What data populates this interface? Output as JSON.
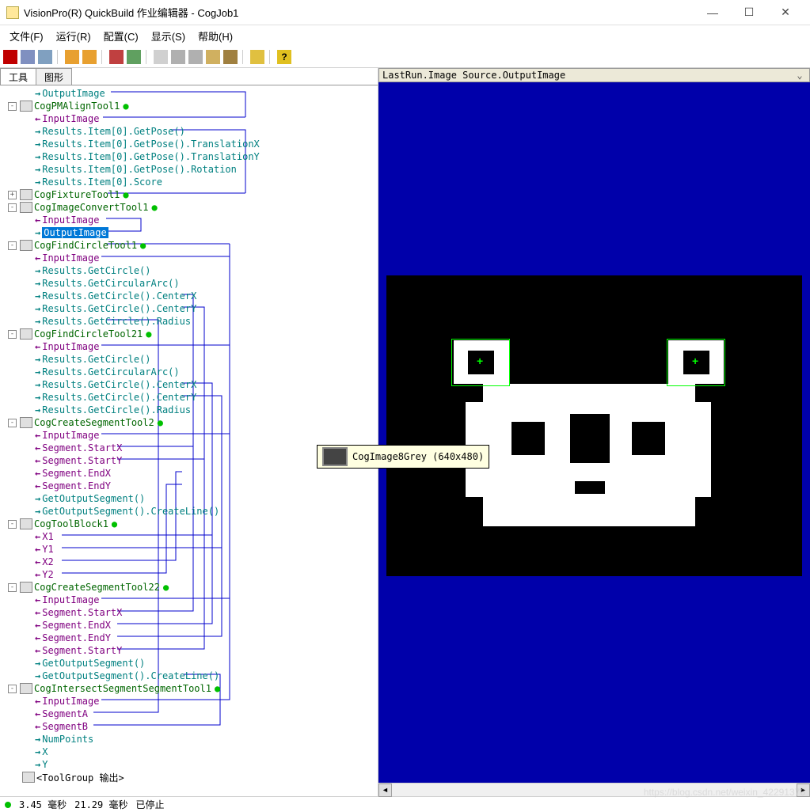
{
  "title": "VisionPro(R) QuickBuild 作业编辑器 - CogJob1",
  "menu": {
    "file": "文件(F)",
    "run": "运行(R)",
    "config": "配置(C)",
    "show": "显示(S)",
    "help": "帮助(H)"
  },
  "tabs": {
    "tools": "工具",
    "graphics": "图形"
  },
  "image_header": "LastRun.Image Source.OutputImage",
  "tooltip": "CogImage8Grey (640x480)",
  "status": {
    "t1": "3.45 毫秒",
    "t2": "21.29 毫秒",
    "state": "已停止"
  },
  "watermark": "https://blog.csdn.net/weixin_42291376",
  "tree": [
    {
      "indent": 42,
      "arrow": "out",
      "text": "OutputImage",
      "cls": "label-out"
    },
    {
      "indent": 10,
      "exp": "-",
      "icon": true,
      "text": "CogPMAlignTool1",
      "cls": "label-tool",
      "dot": true
    },
    {
      "indent": 42,
      "arrow": "in",
      "text": "InputImage",
      "cls": "label-in"
    },
    {
      "indent": 42,
      "arrow": "out",
      "text": "Results.Item[0].GetPose()",
      "cls": "label-out"
    },
    {
      "indent": 42,
      "arrow": "out",
      "text": "Results.Item[0].GetPose().TranslationX",
      "cls": "label-out"
    },
    {
      "indent": 42,
      "arrow": "out",
      "text": "Results.Item[0].GetPose().TranslationY",
      "cls": "label-out"
    },
    {
      "indent": 42,
      "arrow": "out",
      "text": "Results.Item[0].GetPose().Rotation",
      "cls": "label-out"
    },
    {
      "indent": 42,
      "arrow": "out",
      "text": "Results.Item[0].Score",
      "cls": "label-out"
    },
    {
      "indent": 10,
      "exp": "+",
      "icon": true,
      "text": "CogFixtureTool1",
      "cls": "label-tool",
      "dot": true
    },
    {
      "indent": 10,
      "exp": "-",
      "icon": true,
      "text": "CogImageConvertTool1",
      "cls": "label-tool",
      "dot": true
    },
    {
      "indent": 42,
      "arrow": "in",
      "text": "InputImage",
      "cls": "label-in"
    },
    {
      "indent": 42,
      "arrow": "out",
      "text": "OutputImage",
      "cls": "label-out",
      "selected": true
    },
    {
      "indent": 10,
      "exp": "-",
      "icon": true,
      "text": "CogFindCircleTool1",
      "cls": "label-tool",
      "dot": true
    },
    {
      "indent": 42,
      "arrow": "in",
      "text": "InputImage",
      "cls": "label-in"
    },
    {
      "indent": 42,
      "arrow": "out",
      "text": "Results.GetCircle()",
      "cls": "label-out"
    },
    {
      "indent": 42,
      "arrow": "out",
      "text": "Results.GetCircularArc()",
      "cls": "label-out"
    },
    {
      "indent": 42,
      "arrow": "out",
      "text": "Results.GetCircle().CenterX",
      "cls": "label-out"
    },
    {
      "indent": 42,
      "arrow": "out",
      "text": "Results.GetCircle().CenterY",
      "cls": "label-out"
    },
    {
      "indent": 42,
      "arrow": "out",
      "text": "Results.GetCircle().Radius",
      "cls": "label-out"
    },
    {
      "indent": 10,
      "exp": "-",
      "icon": true,
      "text": "CogFindCircleTool21",
      "cls": "label-tool",
      "dot": true
    },
    {
      "indent": 42,
      "arrow": "in",
      "text": "InputImage",
      "cls": "label-in"
    },
    {
      "indent": 42,
      "arrow": "out",
      "text": "Results.GetCircle()",
      "cls": "label-out"
    },
    {
      "indent": 42,
      "arrow": "out",
      "text": "Results.GetCircularArc()",
      "cls": "label-out"
    },
    {
      "indent": 42,
      "arrow": "out",
      "text": "Results.GetCircle().CenterX",
      "cls": "label-out"
    },
    {
      "indent": 42,
      "arrow": "out",
      "text": "Results.GetCircle().CenterY",
      "cls": "label-out"
    },
    {
      "indent": 42,
      "arrow": "out",
      "text": "Results.GetCircle().Radius",
      "cls": "label-out"
    },
    {
      "indent": 10,
      "exp": "-",
      "icon": true,
      "text": "CogCreateSegmentTool2",
      "cls": "label-tool",
      "dot": true
    },
    {
      "indent": 42,
      "arrow": "in",
      "text": "InputImage",
      "cls": "label-in"
    },
    {
      "indent": 42,
      "arrow": "in",
      "text": "Segment.StartX",
      "cls": "label-in"
    },
    {
      "indent": 42,
      "arrow": "in",
      "text": "Segment.StartY",
      "cls": "label-in"
    },
    {
      "indent": 42,
      "arrow": "in",
      "text": "Segment.EndX",
      "cls": "label-in"
    },
    {
      "indent": 42,
      "arrow": "in",
      "text": "Segment.EndY",
      "cls": "label-in"
    },
    {
      "indent": 42,
      "arrow": "out",
      "text": "GetOutputSegment()",
      "cls": "label-out"
    },
    {
      "indent": 42,
      "arrow": "out",
      "text": "GetOutputSegment().CreateLine()",
      "cls": "label-out"
    },
    {
      "indent": 10,
      "exp": "-",
      "icon": true,
      "text": "CogToolBlock1",
      "cls": "label-tool",
      "dot": true
    },
    {
      "indent": 42,
      "arrow": "in",
      "text": "X1",
      "cls": "label-in"
    },
    {
      "indent": 42,
      "arrow": "in",
      "text": "Y1",
      "cls": "label-in"
    },
    {
      "indent": 42,
      "arrow": "in",
      "text": "X2",
      "cls": "label-in"
    },
    {
      "indent": 42,
      "arrow": "in",
      "text": "Y2",
      "cls": "label-in"
    },
    {
      "indent": 10,
      "exp": "-",
      "icon": true,
      "text": "CogCreateSegmentTool22",
      "cls": "label-tool",
      "dot": true
    },
    {
      "indent": 42,
      "arrow": "in",
      "text": "InputImage",
      "cls": "label-in"
    },
    {
      "indent": 42,
      "arrow": "in",
      "text": "Segment.StartX",
      "cls": "label-in"
    },
    {
      "indent": 42,
      "arrow": "in",
      "text": "Segment.EndX",
      "cls": "label-in"
    },
    {
      "indent": 42,
      "arrow": "in",
      "text": "Segment.EndY",
      "cls": "label-in"
    },
    {
      "indent": 42,
      "arrow": "in",
      "text": "Segment.StartY",
      "cls": "label-in"
    },
    {
      "indent": 42,
      "arrow": "out",
      "text": "GetOutputSegment()",
      "cls": "label-out"
    },
    {
      "indent": 42,
      "arrow": "out",
      "text": "GetOutputSegment().CreateLine()",
      "cls": "label-out"
    },
    {
      "indent": 10,
      "exp": "-",
      "icon": true,
      "text": "CogIntersectSegmentSegmentTool1",
      "cls": "label-tool",
      "dot": true
    },
    {
      "indent": 42,
      "arrow": "in",
      "text": "InputImage",
      "cls": "label-in"
    },
    {
      "indent": 42,
      "arrow": "in",
      "text": "SegmentA",
      "cls": "label-in"
    },
    {
      "indent": 42,
      "arrow": "in",
      "text": "SegmentB",
      "cls": "label-in"
    },
    {
      "indent": 42,
      "arrow": "out",
      "text": "NumPoints",
      "cls": "label-out"
    },
    {
      "indent": 42,
      "arrow": "out",
      "text": "X",
      "cls": "label-out"
    },
    {
      "indent": 42,
      "arrow": "out",
      "text": "Y",
      "cls": "label-out"
    },
    {
      "indent": 26,
      "icon": true,
      "text": "<ToolGroup 输出>",
      "cls": ""
    }
  ],
  "wires": [
    [
      140,
      8,
      310,
      8,
      310,
      40
    ],
    [
      310,
      40,
      130,
      40
    ],
    [
      216,
      56,
      310,
      56,
      310,
      136
    ],
    [
      310,
      136,
      136,
      136
    ],
    [
      134,
      168,
      178,
      168,
      178,
      184,
      128,
      184
    ],
    [
      134,
      200,
      290,
      200
    ],
    [
      290,
      200,
      290,
      216,
      128,
      216
    ],
    [
      290,
      216,
      290,
      328,
      128,
      328
    ],
    [
      290,
      328,
      290,
      440,
      128,
      440
    ],
    [
      290,
      440,
      290,
      648,
      128,
      648
    ],
    [
      290,
      648,
      290,
      776,
      128,
      776
    ],
    [
      230,
      264,
      244,
      264,
      244,
      456,
      148,
      456
    ],
    [
      230,
      280,
      258,
      280,
      258,
      472,
      148,
      472
    ],
    [
      230,
      376,
      268,
      376,
      268,
      568,
      78,
      568
    ],
    [
      230,
      392,
      280,
      392,
      280,
      584,
      78,
      584
    ],
    [
      230,
      488,
      222,
      488,
      222,
      600,
      78,
      600
    ],
    [
      230,
      504,
      210,
      504,
      210,
      616,
      78,
      616
    ],
    [
      148,
      456,
      244,
      456,
      244,
      664,
      148,
      664
    ],
    [
      148,
      472,
      258,
      472,
      258,
      712,
      148,
      712
    ],
    [
      128,
      328,
      290,
      328
    ],
    [
      134,
      296,
      200,
      296,
      200,
      792,
      118,
      792
    ],
    [
      232,
      744,
      278,
      744,
      278,
      808,
      118,
      808
    ],
    [
      230,
      376,
      268,
      376,
      268,
      680,
      148,
      680
    ],
    [
      230,
      392,
      280,
      392,
      280,
      696,
      148,
      696
    ]
  ]
}
